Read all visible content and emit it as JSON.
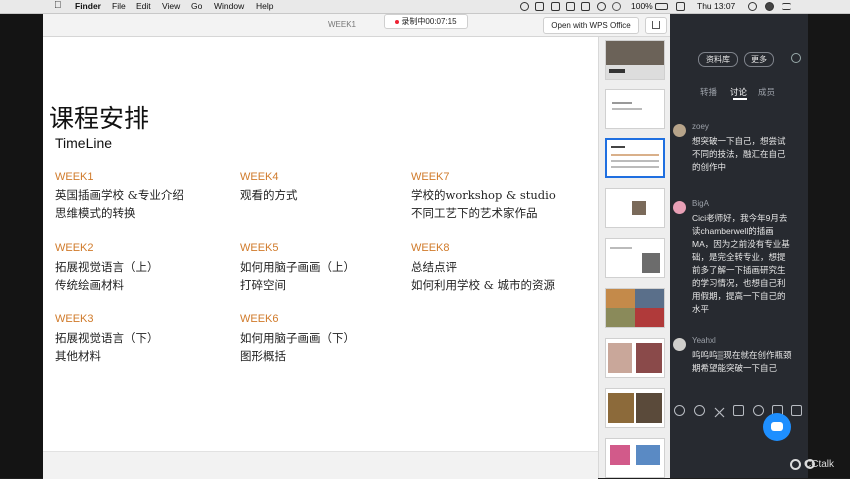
{
  "menubar": {
    "apple": "",
    "app": "Finder",
    "items": [
      "File",
      "Edit",
      "View",
      "Go",
      "Window",
      "Help"
    ],
    "battery": "100%",
    "datetime": "Thu 13:07"
  },
  "viewer": {
    "doc_title": "WEEK1",
    "recording": "录制中00:07:15",
    "open_with": "Open with WPS Office"
  },
  "slide": {
    "title": "课程安排",
    "subtitle": "TimeLine",
    "weeks": [
      {
        "label": "WEEK1",
        "lines": [
          "英国插画学校 &专业介绍",
          "思维模式的转换"
        ]
      },
      {
        "label": "WEEK2",
        "lines": [
          "拓展视觉语言（上）",
          "传统绘画材料"
        ]
      },
      {
        "label": "WEEK3",
        "lines": [
          "拓展视觉语言（下）",
          "其他材料"
        ]
      },
      {
        "label": "WEEK4",
        "lines": [
          "观看的方式"
        ]
      },
      {
        "label": "WEEK5",
        "lines": [
          "如何用脑子画画（上）",
          "打碎空间"
        ]
      },
      {
        "label": "WEEK6",
        "lines": [
          "如何用脑子画画（下）",
          "图形概括"
        ]
      },
      {
        "label": "WEEK7",
        "lines": [
          "学校的workshop & studio",
          "不同工艺下的艺术家作品"
        ]
      },
      {
        "label": "WEEK8",
        "lines": [
          "总结点评",
          "如何利用学校 & 城市的资源"
        ]
      }
    ],
    "week_color": "#d07a2a"
  },
  "chat": {
    "buttons": [
      "资料库",
      "更多"
    ],
    "tabs": [
      "转播",
      "讨论",
      "成员"
    ],
    "active_tab": "讨论",
    "messages": [
      {
        "user": "zoey",
        "text": "想突破一下自己，想尝试不同的技法，融汇在自己的创作中"
      },
      {
        "user": "BigA",
        "text": "Cici老师好，我今年9月去读chamberwell的插画MA，因为之前没有专业基础，是完全转专业，想提前多了解一下插画研究生的学习情况，也想自己利用假期，提高一下自己的水平"
      },
      {
        "user": "Yeahxl",
        "text": "呜呜呜▒现在就在创作瓶颈期希望能突破一下自己"
      }
    ],
    "brand": "CCtalk",
    "accent": "#1e8fff"
  }
}
